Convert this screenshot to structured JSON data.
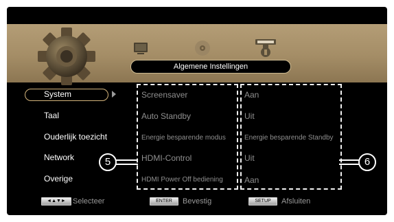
{
  "header": {
    "title": "Algemene Instellingen"
  },
  "icons": {
    "main": "gear-icon",
    "secondary": [
      "tv-icon",
      "disc-icon",
      "usb-icon"
    ]
  },
  "menu": {
    "selected_index": 0,
    "items": [
      {
        "label": "System"
      },
      {
        "label": "Taal"
      },
      {
        "label": "Ouderlijk toezicht"
      },
      {
        "label": "Network"
      },
      {
        "label": "Overige"
      }
    ]
  },
  "settings": {
    "labels": [
      "Screensaver",
      "Auto Standby",
      "Energie besparende modus",
      "HDMI-Control",
      "HDMI Power Off bediening"
    ],
    "values": [
      "Aan",
      "Uit",
      "Energie besparende Standby",
      "Uit",
      "Aan"
    ]
  },
  "callouts": [
    "5",
    "6"
  ],
  "footer": {
    "items": [
      {
        "key": "◄▲▼►",
        "label": "Selecteer"
      },
      {
        "key": "ENTER",
        "label": "Bevestig"
      },
      {
        "key": "SETUP",
        "label": "Afsluiten"
      }
    ]
  },
  "colors": {
    "banner": "#a48d66",
    "highlight_border": "#d6b67d",
    "dim_text": "#8f8f8f",
    "active_text": "#ffffff"
  }
}
